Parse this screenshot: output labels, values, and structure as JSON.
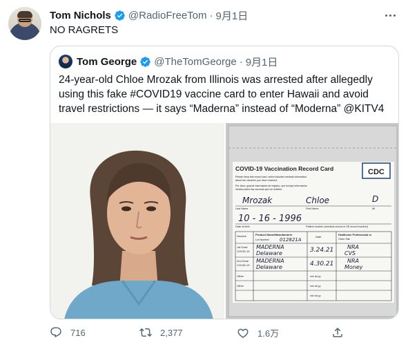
{
  "tweet": {
    "author_name": "Tom Nichols",
    "author_handle": "@RadioFreeTom",
    "separator": "·",
    "time": "9月1日",
    "text": "NO RAGRETS"
  },
  "quoted_tweet": {
    "author_name": "Tom George",
    "author_handle": "@TheTomGeorge",
    "separator": "·",
    "time": "9月1日",
    "text": "24-year-old Chloe Mrozak from Illinois was arrested after allegedly using this fake #COVID19 vaccine card to enter Hawaii and avoid travel restrictions — it says “Maderna” instead of “Moderna” @KITV4"
  },
  "vaccine_card": {
    "title": "COVID-19 Vaccination Record Card",
    "logo_text": "CDC",
    "keep_line_1": "Please keep this record card, which includes medical information",
    "keep_line_2": "about the vaccines you have received.",
    "spanish_line_1": "Por favor, guarde esta tarjeta de registro, que incluye información",
    "spanish_line_2": "médica sobre las vacunas que ha recibido.",
    "last_name_label": "Last Name",
    "first_name_label": "First Name",
    "mi_label": "MI",
    "dob_label": "Date of birth",
    "patient_number_label": "Patient number (medical record or IIS record number)",
    "col_vaccine": "Vaccine",
    "col_product": "Product Name/Manufacturer",
    "col_lot": "Lot Number",
    "col_date": "Date",
    "col_site_1": "Healthcare Professional or",
    "col_site_2": "Clinic Site",
    "row_1st_dose": "1st Dose",
    "row_2nd_dose": "2nd Dose",
    "row_covid": "COVID-19",
    "row_other": "Other",
    "hw_last_name": "Mrozak",
    "hw_first_name": "Chloe",
    "hw_mi": "D",
    "hw_dob": "10 - 16 - 1996",
    "hw_product_1": "MADERNA",
    "hw_lot_1": "Delaware",
    "hw_date_1": "3.24.21",
    "hw_product_2": "MADERNA",
    "hw_lot_2": "Delaware",
    "hw_date_2": "4.30.21",
    "hw_lot_header": "012821A",
    "hw_site_1": "NRA",
    "hw_site_2": "CVS",
    "hw_site_3": "NRA",
    "hw_site_4": "Money",
    "date_placeholder": "mm   dd   yy"
  },
  "actions": {
    "reply_count": "716",
    "retweet_count": "2,377",
    "like_count": "1.6万"
  },
  "colors": {
    "text_primary": "#0f1419",
    "text_secondary": "#536471",
    "verified_blue": "#1d9bf0",
    "border": "#cfd9de"
  },
  "icons": {
    "verified": "verified-badge-icon",
    "more": "more-options-icon",
    "reply": "reply-icon",
    "retweet": "retweet-icon",
    "like": "heart-icon",
    "share": "share-icon"
  }
}
